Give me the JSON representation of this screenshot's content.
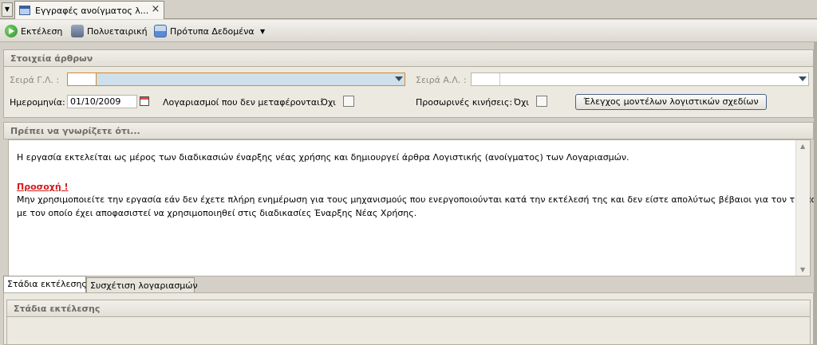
{
  "tab": {
    "title": "Εγγραφές ανοίγματος λ...",
    "close": "×"
  },
  "toolbar": {
    "run_label": "Εκτέλεση",
    "multi_label": "Πολυεταιρική",
    "templates_label": "Πρότυπα Δεδομένα",
    "dropdown_arrow": "▼"
  },
  "articles": {
    "title": "Στοιχεία άρθρων",
    "gl_series_label": "Σειρά Γ.Λ. :",
    "al_series_label": "Σειρά Α.Λ. :",
    "date_label": "Ημερομηνία:",
    "date_value": "01/10/2009",
    "non_transfer_label": "Λογαριασμοί που δεν μεταφέρονται:",
    "non_transfer_value": "Όχι",
    "temp_moves_label": "Προσωρινές κινήσεις:",
    "temp_moves_value": "Όχι",
    "check_button": "Έλεγχος μοντέλων λογιστικών σχεδίων"
  },
  "notice": {
    "title": "Πρέπει να γνωρίζετε ότι...",
    "line1": "Η εργασία εκτελείται ως μέρος των διαδικασιών έναρξης νέας χρήσης και δημιουργεί άρθρα Λογιστικής (ανοίγματος) των Λογαριασμών.",
    "warning": "Προσοχή !",
    "line2": "Μην χρησιμοποιείτε την εργασία εάν δεν έχετε πλήρη ενημέρωση για τους μηχανισμούς που ενεργοποιούνται κατά την εκτέλεσή της και δεν είστε απολύτως βέβαιοι για τον τρόπο",
    "line3": "με τον οποίο έχει αποφασιστεί να χρησιμοποιηθεί στις διαδικασίες Έναρξης Νέας Χρήσης."
  },
  "subtabs": [
    {
      "label": "Στάδια εκτέλεσης"
    },
    {
      "label": "Συσχέτιση λογαριασμών"
    }
  ],
  "stages": {
    "title": "Στάδια εκτέλεσης"
  },
  "colors": {
    "focus_border": "#d18a34",
    "warning_red": "#d11b1b",
    "panel_bg": "#ece9e1"
  }
}
